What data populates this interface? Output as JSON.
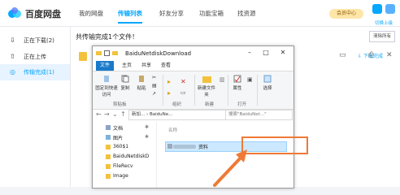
{
  "app": {
    "brand": "百度网盘",
    "vip_label": "会员中心",
    "switch_account": "切换上级"
  },
  "nav": [
    {
      "label": "我的网盘"
    },
    {
      "label": "传输列表",
      "active": true
    },
    {
      "label": "好友分享"
    },
    {
      "label": "功能宝箱"
    },
    {
      "label": "找资源"
    }
  ],
  "sidebar": {
    "items": [
      {
        "icon": "download-icon",
        "label": "正在下载(2)"
      },
      {
        "icon": "upload-icon",
        "label": "正在上传"
      },
      {
        "icon": "check-circle-icon",
        "label": "传输完成(1)",
        "active": true
      }
    ]
  },
  "main": {
    "banner": "共传输完成1个文件！",
    "clear_button": "清除所有",
    "download_folder_link": "下载完成"
  },
  "explorer": {
    "title": "BaiduNetdiskDownload",
    "tabs": [
      "文件",
      "主页",
      "共享",
      "查看"
    ],
    "ribbon": {
      "buttons": {
        "pin": "固定到快速访问",
        "copy": "复制",
        "paste": "粘贴",
        "new_folder": "新建文件夹",
        "properties": "属性",
        "select": "选择"
      },
      "groups": {
        "clipboard": "剪贴板",
        "organize": "组织",
        "new": "新建",
        "open": "打开"
      }
    },
    "address": {
      "path": "新加... › BaiduNe...",
      "search_placeholder": "搜索\"BaiduNet...\""
    },
    "nav_items": [
      "文档",
      "图片",
      "360$1",
      "BaiduNetdiskD",
      "FileRecv",
      "Image"
    ],
    "column_name": "名称",
    "file_name_suffix": "资料"
  },
  "colors": {
    "accent": "#06a7ff",
    "highlight": "#ee7a36",
    "ribbon_file_tab": "#1979ca"
  }
}
